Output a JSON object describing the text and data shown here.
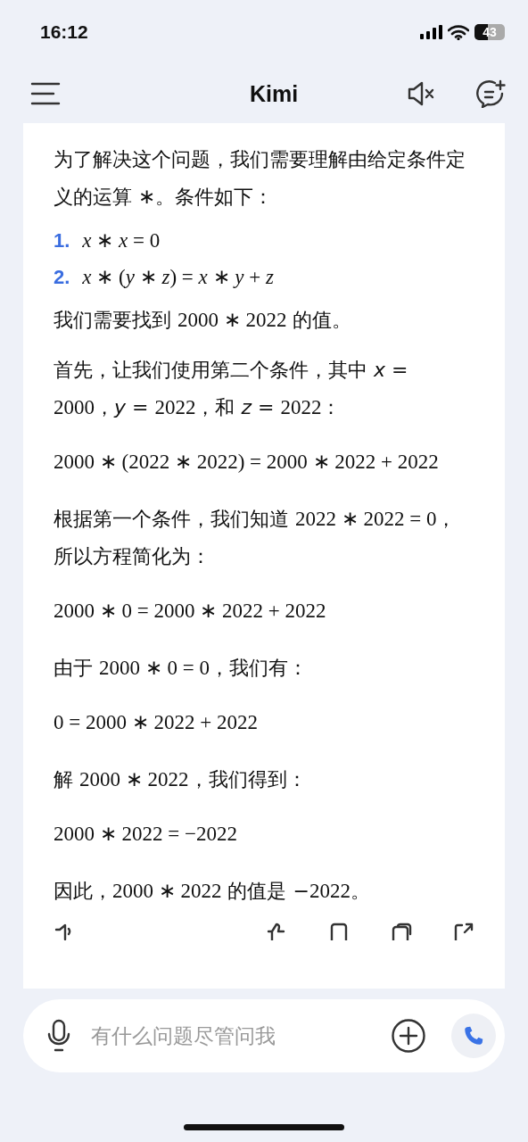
{
  "status_bar": {
    "time": "16:12",
    "battery": "43"
  },
  "header": {
    "title": "Kimi"
  },
  "message": [
    {
      "kind": "paragraph",
      "text": "为了解决这个问题，我们需要理解由给定条件定义的运算 *∗*。条件如下："
    },
    {
      "kind": "list_item",
      "number": "1.",
      "text": "*x* ∗ *x* = 0"
    },
    {
      "kind": "list_item",
      "number": "2.",
      "text": "*x* ∗ (*y* ∗ *z*) = *x* ∗ *y* + *z*"
    },
    {
      "kind": "paragraph",
      "text": "我们需要找到 2000 ∗ 2022 的值。"
    },
    {
      "kind": "paragraph",
      "text": "首先，让我们使用第二个条件，其中 *x* = 2000，*y* = 2022，和 *z* = 2022："
    },
    {
      "kind": "equation",
      "text": "2000 ∗ (2022 ∗ 2022) = 2000 ∗ 2022 + 2022"
    },
    {
      "kind": "paragraph",
      "text": "根据第一个条件，我们知道 2022 ∗ 2022 = 0，所以方程简化为："
    },
    {
      "kind": "equation",
      "text": "2000 ∗ 0 = 2000 ∗ 2022 + 2022"
    },
    {
      "kind": "paragraph",
      "text": "由于 2000 ∗ 0 = 0，我们有："
    },
    {
      "kind": "equation",
      "text": "0 = 2000 ∗ 2022 + 2022"
    },
    {
      "kind": "paragraph",
      "text": "解 2000 ∗ 2022，我们得到："
    },
    {
      "kind": "equation",
      "text": "2000 ∗ 2022 = −2022"
    },
    {
      "kind": "paragraph",
      "text": "因此，2000 ∗ 2022 的值是 −2022。"
    }
  ],
  "input": {
    "placeholder": "有什么问题尽管问我"
  }
}
